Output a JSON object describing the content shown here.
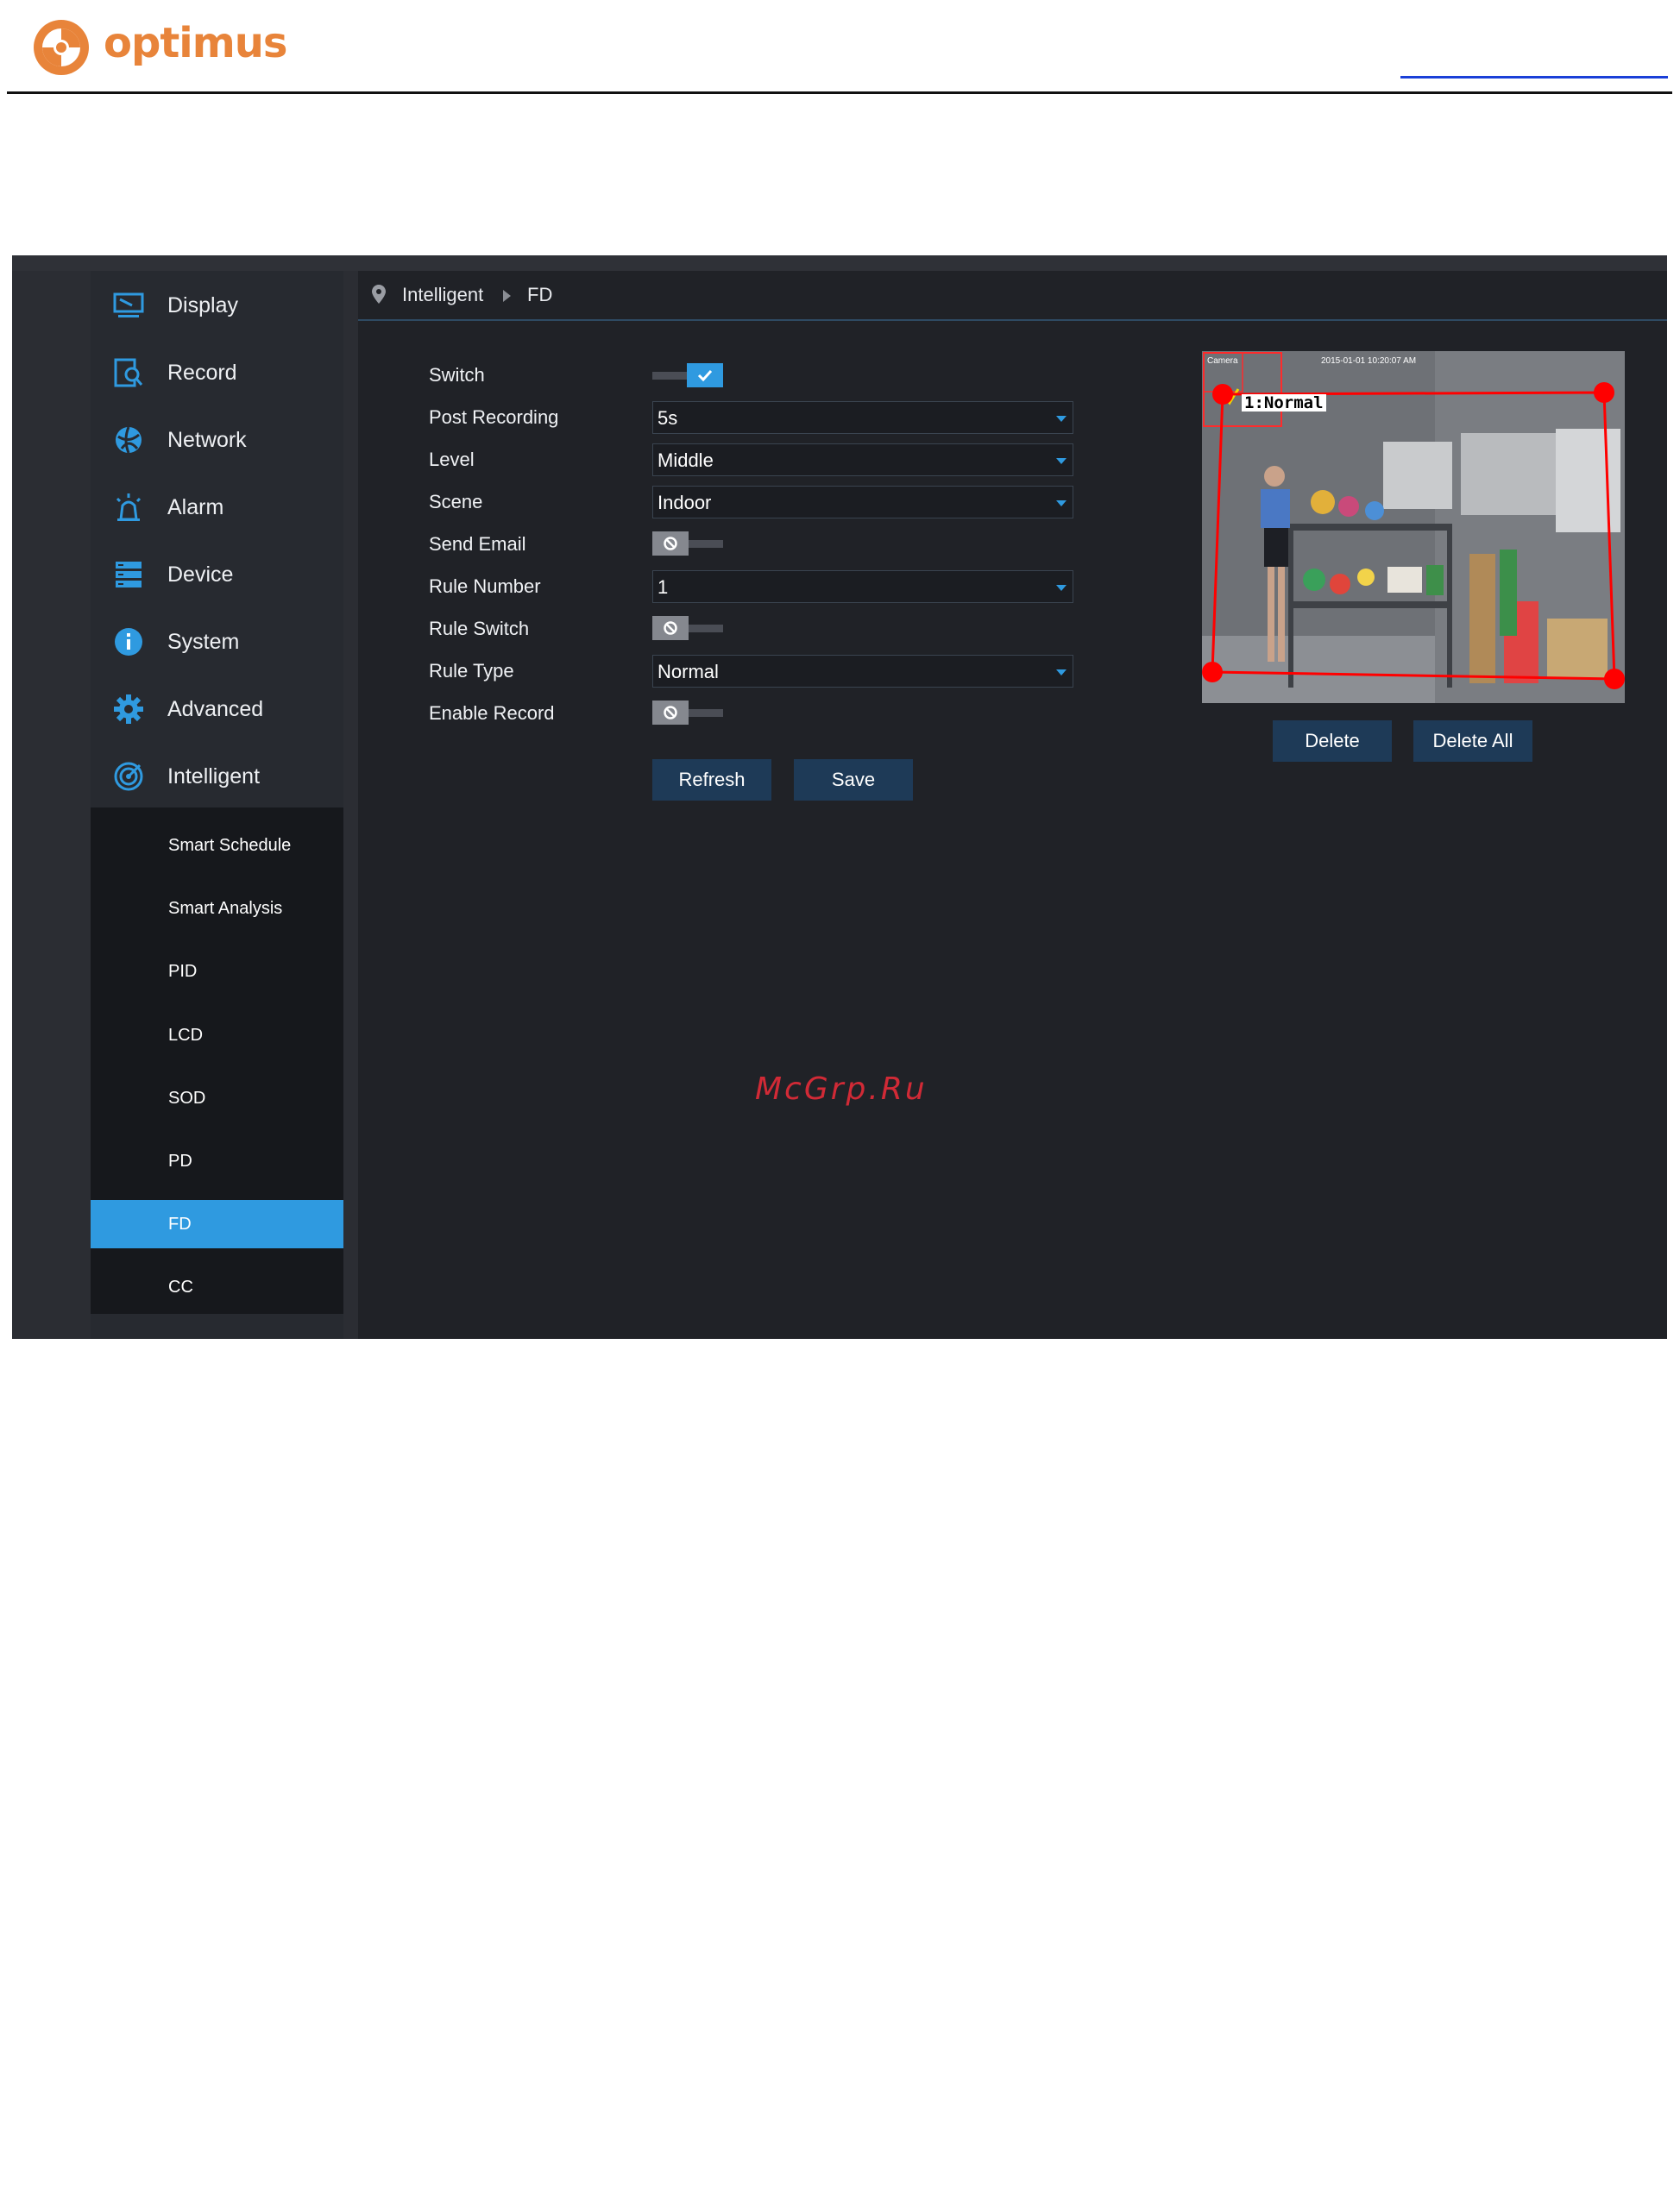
{
  "document": {
    "brand": "optimus",
    "watermark": "McGrp.Ru"
  },
  "colors": {
    "accent": "#2f9ae0",
    "brand_orange": "#e8843a",
    "sidebar_bg": "#272a30",
    "submenu_bg": "#16181c",
    "panel_bg": "#202227",
    "button_bg": "#1e3a57",
    "rule_red": "#ff0000"
  },
  "sidebar": {
    "items": [
      {
        "label": "Display",
        "icon": "monitor-icon"
      },
      {
        "label": "Record",
        "icon": "record-search-icon"
      },
      {
        "label": "Network",
        "icon": "network-globe-icon"
      },
      {
        "label": "Alarm",
        "icon": "alarm-siren-icon"
      },
      {
        "label": "Device",
        "icon": "device-storage-icon"
      },
      {
        "label": "System",
        "icon": "info-icon"
      },
      {
        "label": "Advanced",
        "icon": "gear-icon"
      },
      {
        "label": "Intelligent",
        "icon": "intelligent-radar-icon"
      }
    ],
    "submenu": [
      {
        "label": "Smart Schedule",
        "active": false
      },
      {
        "label": "Smart Analysis",
        "active": false
      },
      {
        "label": "PID",
        "active": false
      },
      {
        "label": "LCD",
        "active": false
      },
      {
        "label": "SOD",
        "active": false
      },
      {
        "label": "PD",
        "active": false
      },
      {
        "label": "FD",
        "active": true
      },
      {
        "label": "CC",
        "active": false
      }
    ]
  },
  "breadcrumb": {
    "icon": "location-pin-icon",
    "items": [
      "Intelligent",
      "FD"
    ]
  },
  "form": {
    "switch": {
      "label": "Switch",
      "on": true
    },
    "post_recording": {
      "label": "Post Recording",
      "value": "5s"
    },
    "level": {
      "label": "Level",
      "value": "Middle"
    },
    "scene": {
      "label": "Scene",
      "value": "Indoor"
    },
    "send_email": {
      "label": "Send Email",
      "on": false
    },
    "rule_number": {
      "label": "Rule Number",
      "value": "1"
    },
    "rule_switch": {
      "label": "Rule Switch",
      "on": false
    },
    "rule_type": {
      "label": "Rule Type",
      "value": "Normal"
    },
    "enable_record": {
      "label": "Enable Record",
      "on": false
    }
  },
  "buttons": {
    "refresh": "Refresh",
    "save": "Save",
    "delete": "Delete",
    "delete_all": "Delete All"
  },
  "preview": {
    "camera_label": "Camera",
    "timestamp": "2015-01-01 10:20:07 AM",
    "rule_tag": "1:Normal"
  }
}
